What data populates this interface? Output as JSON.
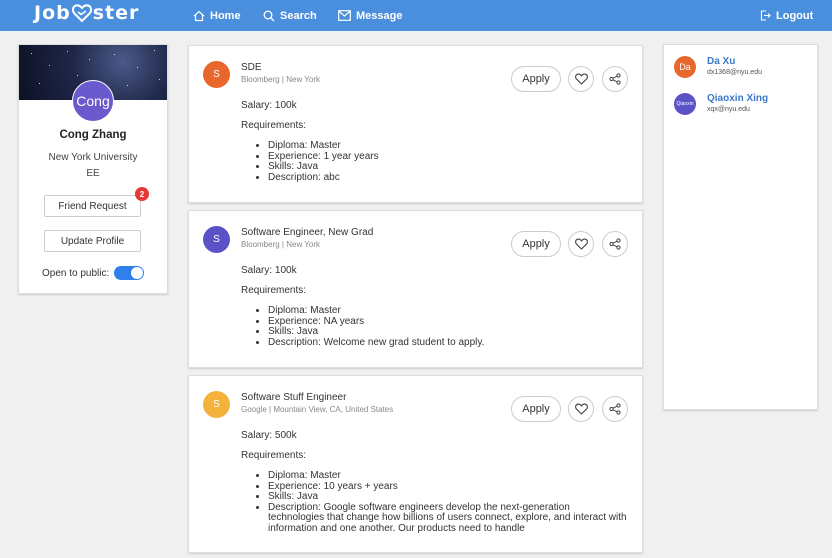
{
  "header": {
    "logo": "Jobster",
    "logo_left": "Job",
    "logo_right": "ster",
    "nav": {
      "home": "Home",
      "search": "Search",
      "message": "Message",
      "logout": "Logout"
    }
  },
  "profile": {
    "avatar_text": "Cong",
    "name": "Cong Zhang",
    "school": "New York University",
    "major": "EE",
    "friend_request_label": "Friend Request",
    "friend_request_count": "2",
    "update_profile_label": "Update Profile",
    "open_to_public_label": "Open to public:",
    "open_to_public": true
  },
  "jobs": [
    {
      "avatar": "S",
      "avatar_color": "#e8672c",
      "title": "SDE",
      "company_location": "Bloomberg | New York",
      "apply_label": "Apply",
      "salary": "Salary: 100k",
      "requirements_label": "Requirements:",
      "requirements": [
        "Diploma: Master",
        "Experience: 1 year years",
        "Skills: Java",
        "Description: abc"
      ]
    },
    {
      "avatar": "S",
      "avatar_color": "#5b52c8",
      "title": "Software Engineer, New Grad",
      "company_location": "Bloomberg | New York",
      "apply_label": "Apply",
      "salary": "Salary: 100k",
      "requirements_label": "Requirements:",
      "requirements": [
        "Diploma: Master",
        "Experience: NA years",
        "Skills: Java",
        "Description: Welcome new grad student to apply."
      ]
    },
    {
      "avatar": "S",
      "avatar_color": "#f4b23c",
      "title": "Software Stuff Engineer",
      "company_location": "Google | Mountain View, CA, United States",
      "apply_label": "Apply",
      "salary": "Salary: 500k",
      "requirements_label": "Requirements:",
      "requirements": [
        "Diploma: Master",
        "Experience: 10 years + years",
        "Skills: Java",
        "Description: Google software engineers develop the next-generation technologies that change how billions of users connect, explore, and interact with information and one another. Our products need to handle"
      ]
    }
  ],
  "friends": [
    {
      "avatar": "Da",
      "avatar_color": "#e8672c",
      "name": "Da Xu",
      "email": "dx1368@nyu.edu"
    },
    {
      "avatar": "Qiaoxin",
      "avatar_color": "#5b52c8",
      "name": "Qiaoxin Xing",
      "email": "xqx@nyu.edu"
    }
  ],
  "colors": {
    "header": "#4a8ede",
    "accent": "#2f80ed",
    "badge": "#e53935",
    "link": "#3a78c9"
  }
}
